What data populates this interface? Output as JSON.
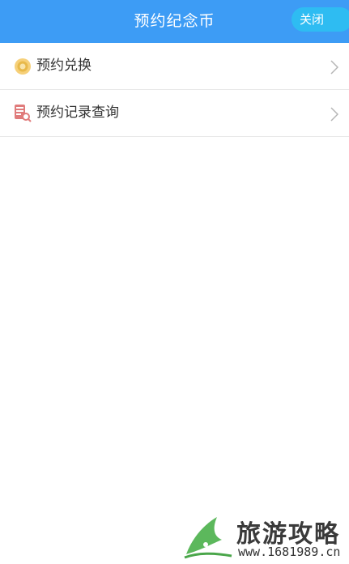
{
  "header": {
    "title": "预约纪念币",
    "close_label": "关闭"
  },
  "menu": {
    "items": [
      {
        "label": "预约兑换",
        "icon": "coin-exchange-icon"
      },
      {
        "label": "预约记录查询",
        "icon": "record-search-icon"
      }
    ]
  },
  "watermark": {
    "text": "旅游攻略",
    "url": "www.1681989.cn"
  },
  "colors": {
    "header_bg": "#3d9cf5",
    "close_bg": "#2ebcf2"
  }
}
